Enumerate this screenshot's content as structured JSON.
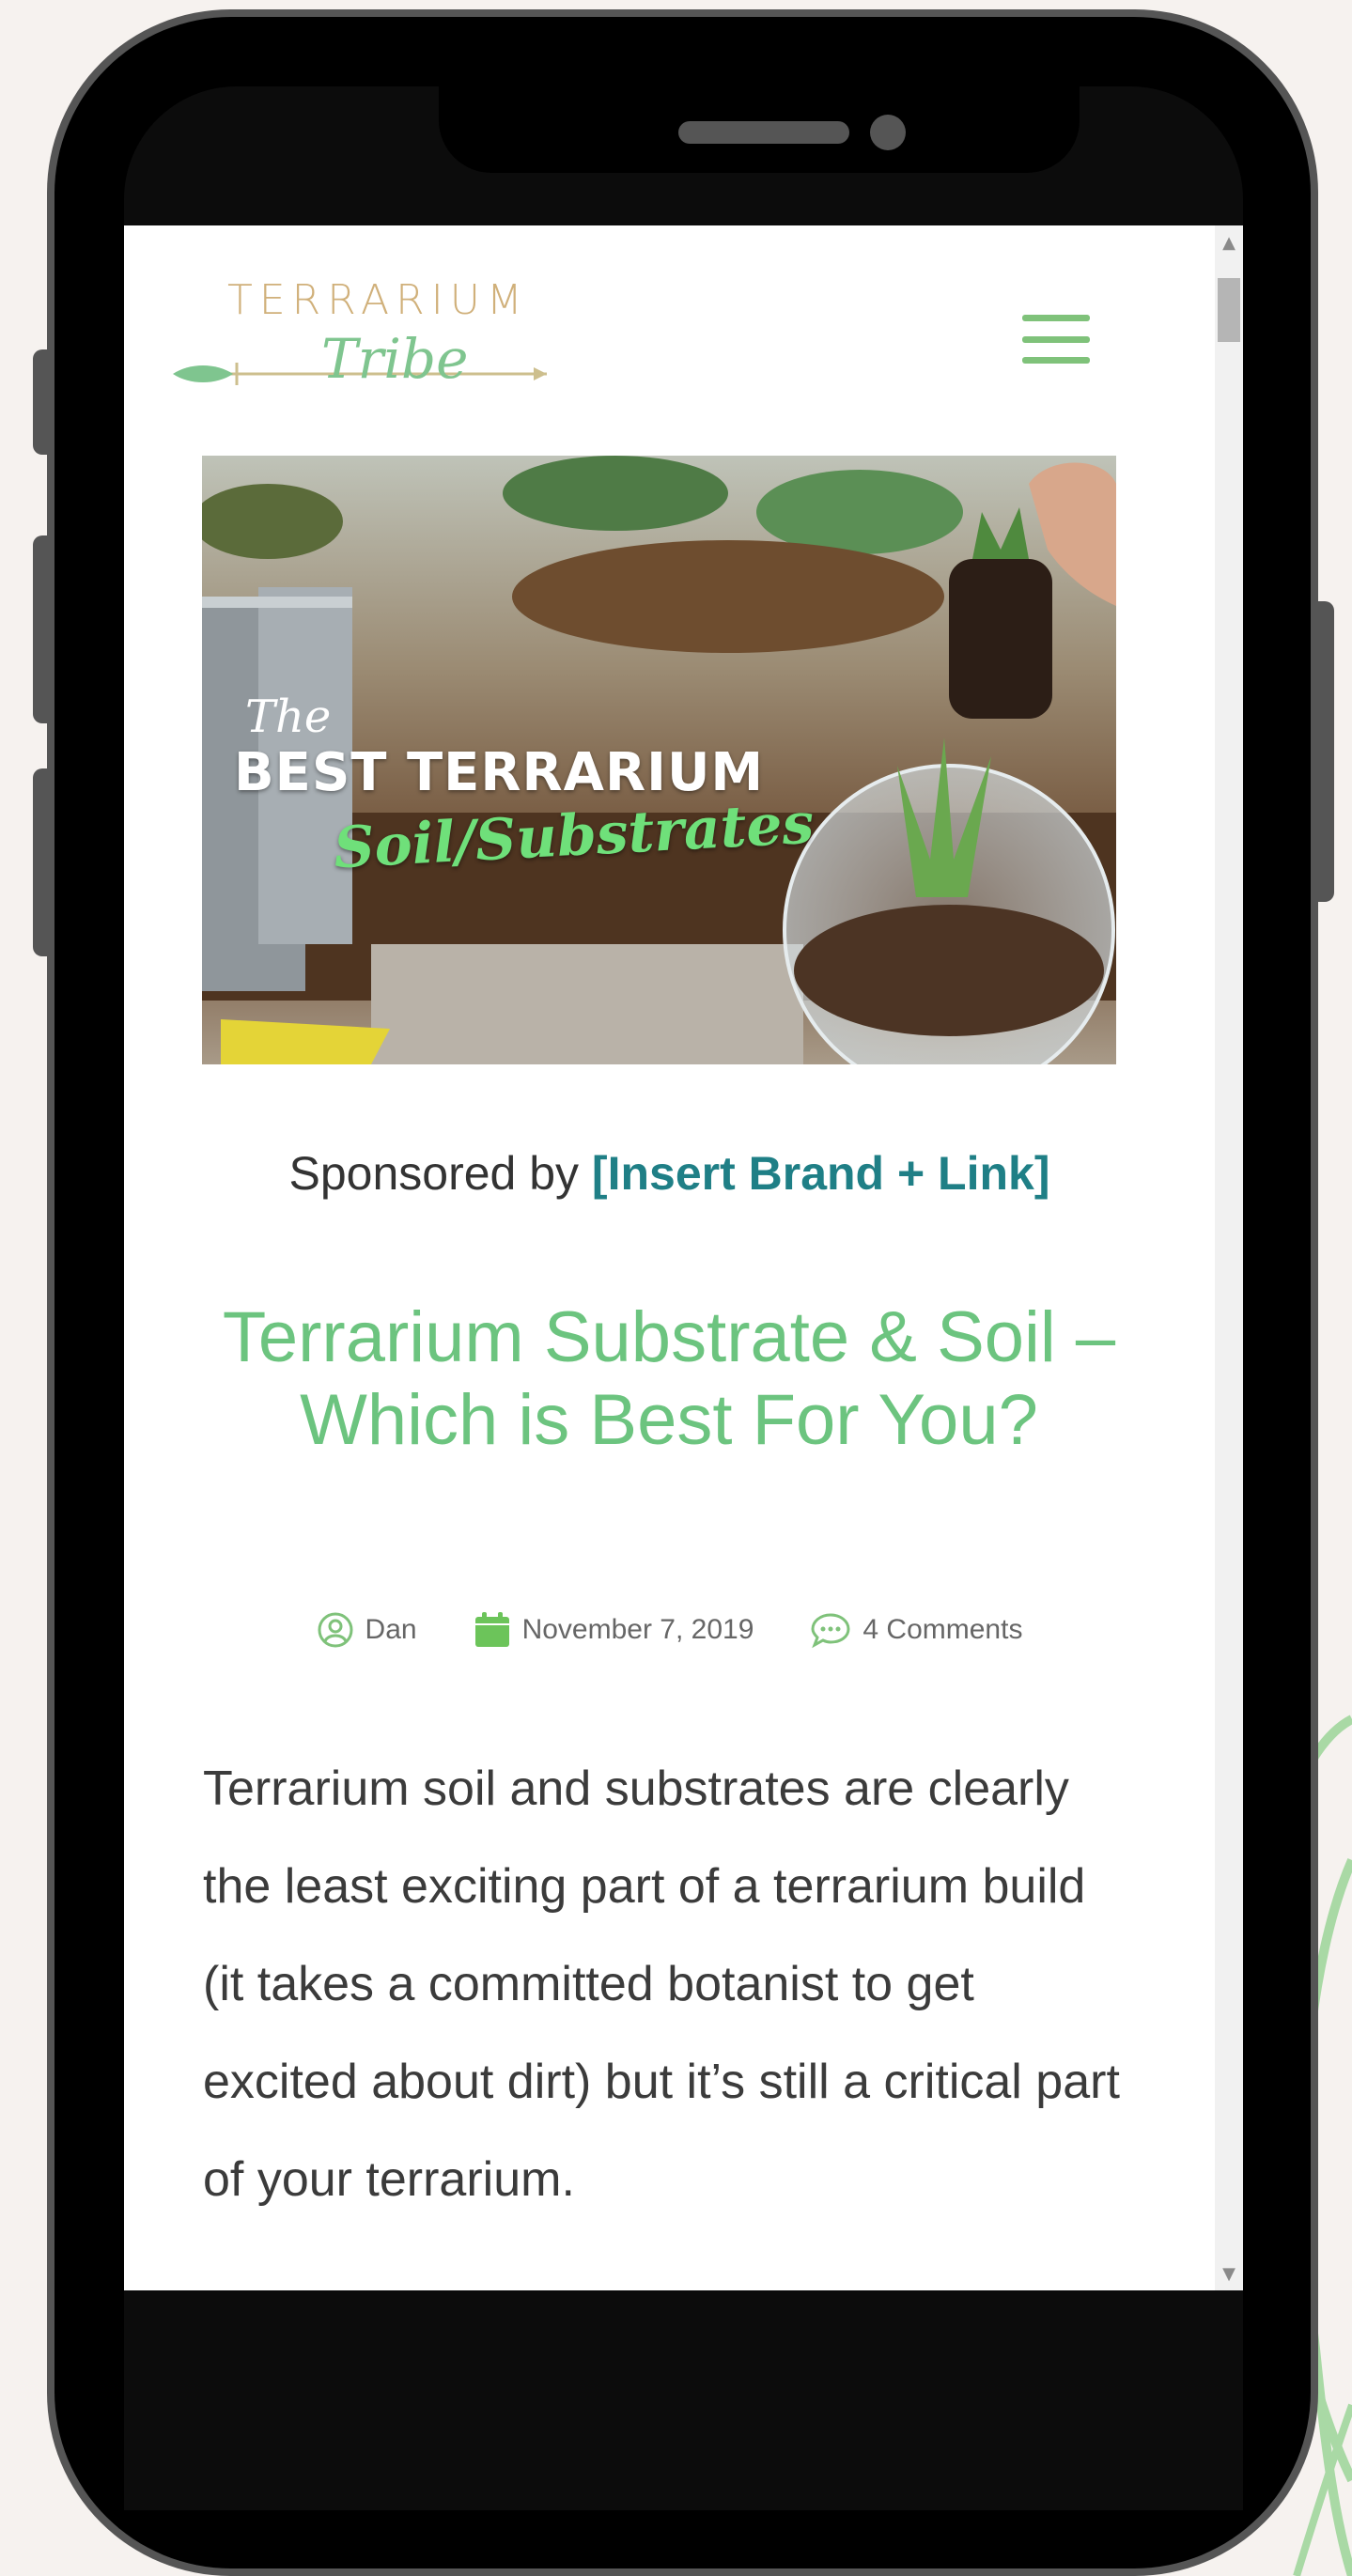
{
  "logo": {
    "word": "TERRARIUM",
    "script": "Tribe"
  },
  "hero": {
    "the": "The",
    "title": "BEST TERRARIUM",
    "subtitle": "Soil/Substrates"
  },
  "sponsored": {
    "prefix": "Sponsored by ",
    "link": "[Insert Brand + Link]"
  },
  "post": {
    "title": "Terrarium Substrate & Soil – Which is Best For You?",
    "author": "Dan",
    "date": "November 7, 2019",
    "comments": "4 Comments",
    "body": "Terrarium soil and substrates are clearly the least exciting part of a terrarium build (it takes a committed botanist to get excited about dirt) but it’s still a critical part of your terrarium."
  },
  "colors": {
    "accent_green": "#6cc47f",
    "link_teal": "#1f7f86",
    "logo_gold": "#d0b07a",
    "menu_green": "#7fc27a"
  },
  "icons": [
    "hamburger-menu-icon",
    "user-icon",
    "calendar-icon",
    "comment-icon",
    "arrow-icon"
  ]
}
